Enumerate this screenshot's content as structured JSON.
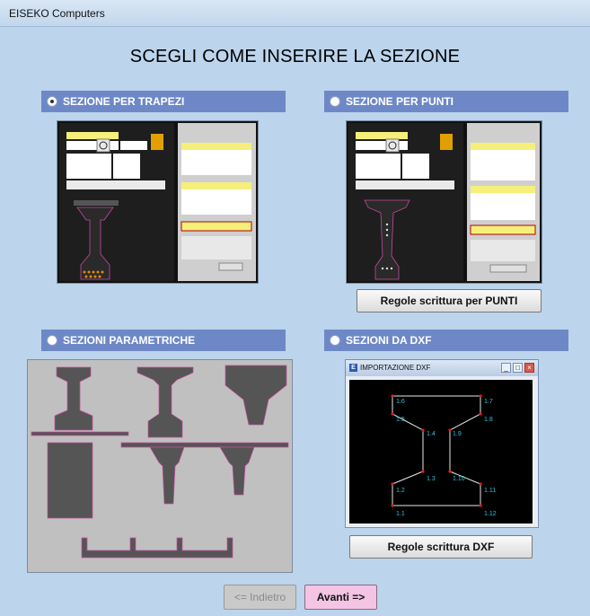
{
  "window": {
    "title": "EISEKO Computers"
  },
  "heading": "SCEGLI COME INSERIRE LA SEZIONE",
  "options": {
    "trapezi": {
      "label": "SEZIONE PER TRAPEZI",
      "selected": true
    },
    "punti": {
      "label": "SEZIONE PER PUNTI",
      "selected": false
    },
    "parametriche": {
      "label": "SEZIONI PARAMETRICHE",
      "selected": false
    },
    "dxf": {
      "label": "SEZIONI DA DXF",
      "selected": false
    }
  },
  "buttons": {
    "regole_punti": "Regole scrittura per PUNTI",
    "regole_dxf": "Regole scrittura DXF",
    "back": "<= Indietro",
    "next": "Avanti =>"
  },
  "dxf_preview": {
    "window_title": "IMPORTAZIONE DXF",
    "point_labels": [
      "1.6",
      "1.7",
      "1.5",
      "1.8",
      "1.4",
      "1.9",
      "1.3",
      "1.10",
      "1.2",
      "1.11",
      "1.1",
      "1.12"
    ]
  },
  "colors": {
    "header_blue": "#6e88c7",
    "background": "#bcd4ec",
    "next_button": "#f4c4e4",
    "dxf_label": "#2fc6d8"
  }
}
